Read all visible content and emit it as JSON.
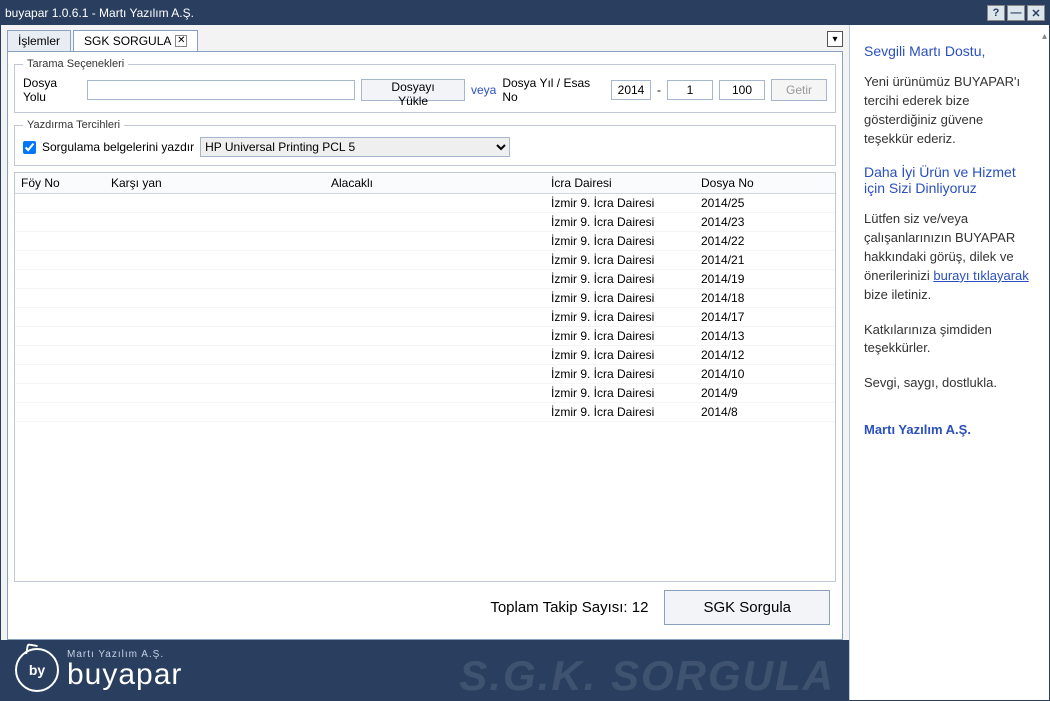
{
  "title": "buyapar 1.0.6.1 - Martı Yazılım A.Ş.",
  "tabs": {
    "islemler": "İşlemler",
    "sgk": "SGK SORGULA"
  },
  "scan": {
    "legend": "Tarama Seçenekleri",
    "dosya_yolu_label": "Dosya Yolu",
    "dosya_yukle": "Dosyayı Yükle",
    "veya": "veya",
    "dosya_yil_label": "Dosya Yıl / Esas No",
    "year": "2014",
    "dash": "-",
    "start": "1",
    "end": "100",
    "getir": "Getir"
  },
  "print": {
    "legend": "Yazdırma Tercihleri",
    "checkbox_label": "Sorgulama belgelerini yazdır",
    "printer": "HP Universal Printing PCL 5"
  },
  "table": {
    "headers": {
      "foy": "Föy No",
      "karsi": "Karşı yan",
      "alacak": "Alacaklı",
      "icra": "İcra Dairesi",
      "dosya": "Dosya No"
    },
    "rows": [
      {
        "icra": "İzmir 9. İcra Dairesi",
        "dosya": "2014/25"
      },
      {
        "icra": "İzmir 9. İcra Dairesi",
        "dosya": "2014/23"
      },
      {
        "icra": "İzmir 9. İcra Dairesi",
        "dosya": "2014/22"
      },
      {
        "icra": "İzmir 9. İcra Dairesi",
        "dosya": "2014/21"
      },
      {
        "icra": "İzmir 9. İcra Dairesi",
        "dosya": "2014/19"
      },
      {
        "icra": "İzmir 9. İcra Dairesi",
        "dosya": "2014/18"
      },
      {
        "icra": "İzmir 9. İcra Dairesi",
        "dosya": "2014/17"
      },
      {
        "icra": "İzmir 9. İcra Dairesi",
        "dosya": "2014/13"
      },
      {
        "icra": "İzmir 9. İcra Dairesi",
        "dosya": "2014/12"
      },
      {
        "icra": "İzmir 9. İcra Dairesi",
        "dosya": "2014/10"
      },
      {
        "icra": "İzmir 9. İcra Dairesi",
        "dosya": "2014/9"
      },
      {
        "icra": "İzmir 9. İcra Dairesi",
        "dosya": "2014/8"
      }
    ]
  },
  "footer": {
    "count_label": "Toplam Takip Sayısı: 12",
    "sorgula": "SGK Sorgula"
  },
  "brand": {
    "small": "Martı Yazılım A.Ş.",
    "name": "buyapar",
    "badge": "by",
    "ghost": "S.G.K. SORGULA"
  },
  "side": {
    "h1": "Sevgili Martı Dostu,",
    "p1": "Yeni ürünümüz BUYAPAR'ı tercihi ederek bize gösterdiğiniz güvene teşekkür ederiz.",
    "h2": "Daha İyi Ürün ve Hizmet için Sizi Dinliyoruz",
    "p2a": "Lütfen siz ve/veya çalışanlarınızın BUYAPAR hakkındaki görüş, dilek ve önerilerinizi ",
    "link": "burayı tıklayarak",
    "p2b": " bize iletiniz.",
    "p3": "Katkılarınıza şimdiden teşekkürler.",
    "p4": "Sevgi, saygı, dostlukla.",
    "sig": "Martı Yazılım A.Ş."
  }
}
